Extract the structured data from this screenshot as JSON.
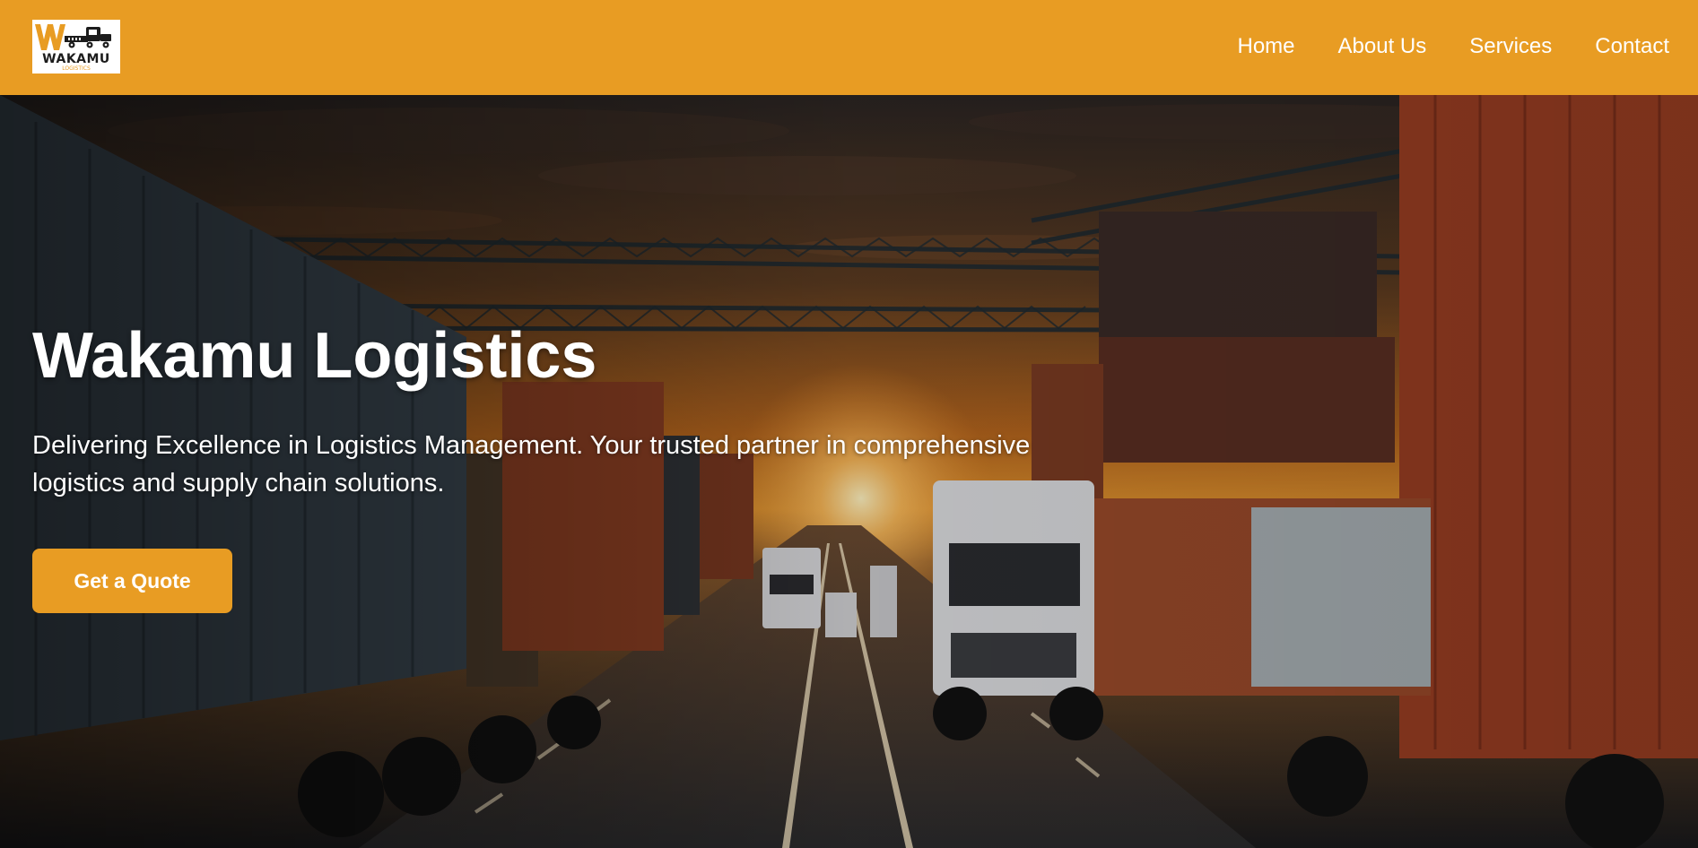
{
  "brand": {
    "logo_word": "WAKAMU",
    "logo_sub": "LOGISTICS",
    "logo_icon": "truck-icon",
    "accent_color": "#E89C23"
  },
  "nav": {
    "items": [
      {
        "label": "Home"
      },
      {
        "label": "About Us"
      },
      {
        "label": "Services"
      },
      {
        "label": "Contact"
      }
    ]
  },
  "hero": {
    "title": "Wakamu Logistics",
    "subtitle": "Delivering Excellence in Logistics Management. Your trusted partner in comprehensive logistics and supply chain solutions.",
    "cta_label": "Get a Quote",
    "background": "sunset port scene with cranes, shipping containers and trucks on a highway"
  }
}
